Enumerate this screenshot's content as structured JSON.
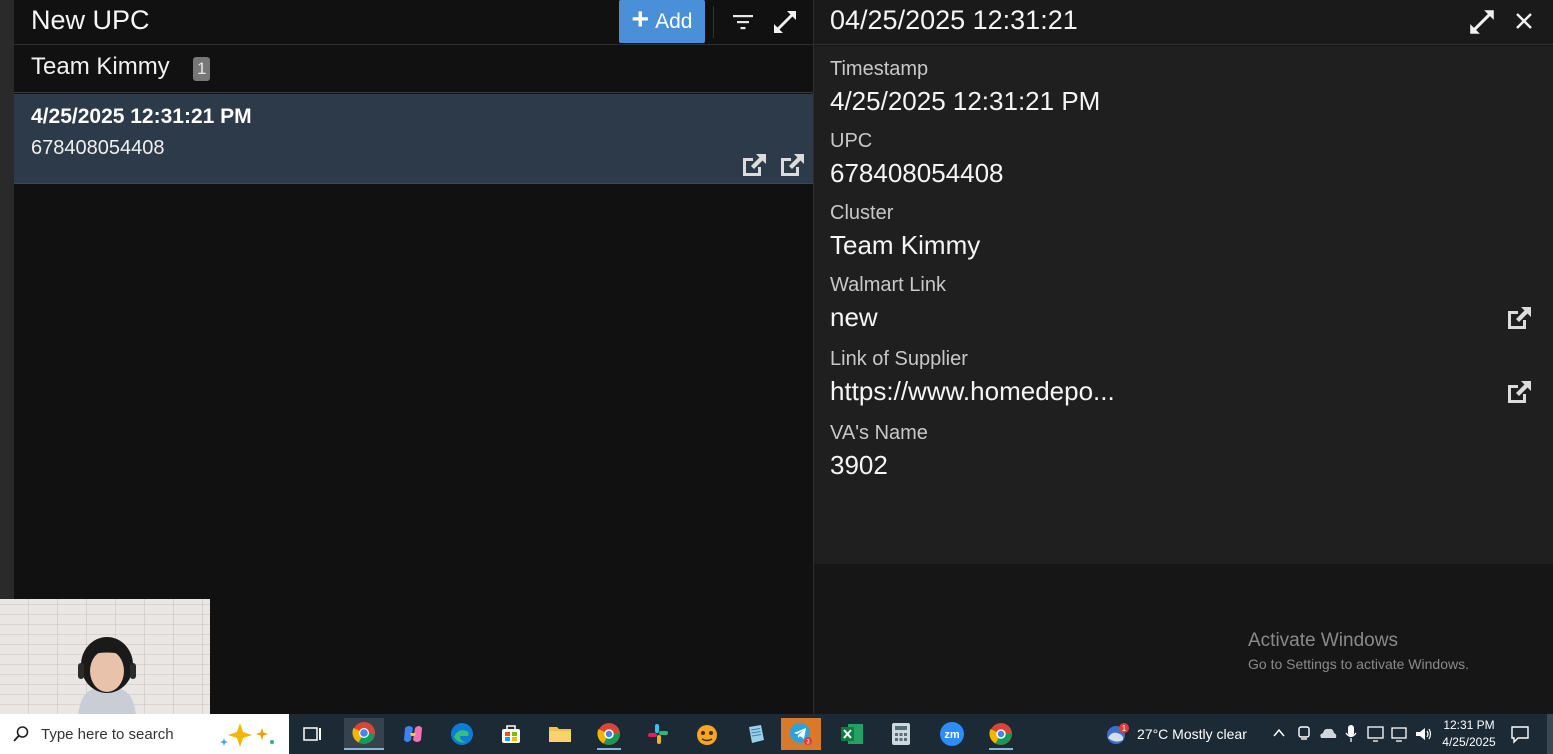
{
  "left": {
    "title": "New UPC",
    "add_label": "Add",
    "group": {
      "name": "Team Kimmy",
      "count": "1"
    },
    "record": {
      "timestamp": "4/25/2025 12:31:21 PM",
      "upc": "678408054408"
    }
  },
  "right": {
    "title": "04/25/2025 12:31:21",
    "fields": [
      {
        "label": "Timestamp",
        "value": "4/25/2025 12:31:21 PM"
      },
      {
        "label": "UPC",
        "value": "678408054408"
      },
      {
        "label": "Cluster",
        "value": "Team Kimmy"
      },
      {
        "label": "Walmart Link",
        "value": "new"
      },
      {
        "label": "Link of Supplier",
        "value": "https://www.homedepo..."
      },
      {
        "label": "VA's Name",
        "value": "3902"
      }
    ],
    "watermark": {
      "line1": "Activate Windows",
      "line2": "Go to Settings to activate Windows."
    }
  },
  "taskbar": {
    "search_placeholder": "Type here to search",
    "weather": "27°C  Mostly clear",
    "weather_badge": "1",
    "time": "12:31 PM",
    "date": "4/25/2025",
    "apps": [
      "task-view",
      "chrome",
      "copilot",
      "edge",
      "store",
      "file-explorer",
      "chrome-profile",
      "slack",
      "game",
      "notes",
      "telegram",
      "excel",
      "calculator",
      "zoom",
      "chrome-t"
    ]
  },
  "colors": {
    "accent": "#4a90d9",
    "selected_row": "#2c3a4a",
    "taskbar": "#1c2a36"
  }
}
